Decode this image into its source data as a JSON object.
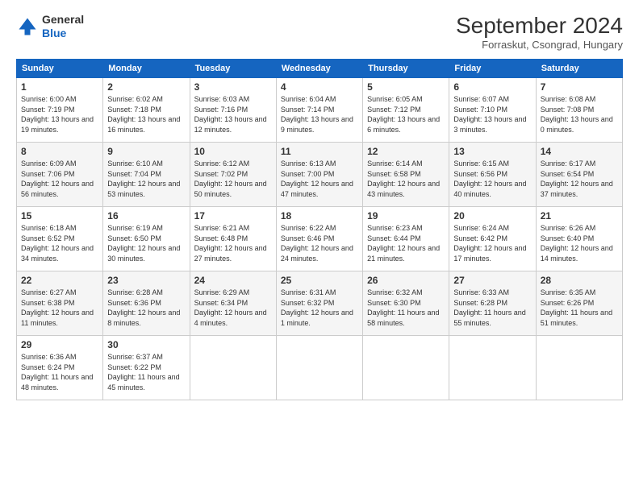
{
  "header": {
    "logo_line1": "General",
    "logo_line2": "Blue",
    "month_title": "September 2024",
    "location": "Forraskut, Csongrad, Hungary"
  },
  "weekdays": [
    "Sunday",
    "Monday",
    "Tuesday",
    "Wednesday",
    "Thursday",
    "Friday",
    "Saturday"
  ],
  "weeks": [
    [
      {
        "day": "1",
        "sunrise": "6:00 AM",
        "sunset": "7:19 PM",
        "daylight": "13 hours and 19 minutes."
      },
      {
        "day": "2",
        "sunrise": "6:02 AM",
        "sunset": "7:18 PM",
        "daylight": "13 hours and 16 minutes."
      },
      {
        "day": "3",
        "sunrise": "6:03 AM",
        "sunset": "7:16 PM",
        "daylight": "13 hours and 12 minutes."
      },
      {
        "day": "4",
        "sunrise": "6:04 AM",
        "sunset": "7:14 PM",
        "daylight": "13 hours and 9 minutes."
      },
      {
        "day": "5",
        "sunrise": "6:05 AM",
        "sunset": "7:12 PM",
        "daylight": "13 hours and 6 minutes."
      },
      {
        "day": "6",
        "sunrise": "6:07 AM",
        "sunset": "7:10 PM",
        "daylight": "13 hours and 3 minutes."
      },
      {
        "day": "7",
        "sunrise": "6:08 AM",
        "sunset": "7:08 PM",
        "daylight": "13 hours and 0 minutes."
      }
    ],
    [
      {
        "day": "8",
        "sunrise": "6:09 AM",
        "sunset": "7:06 PM",
        "daylight": "12 hours and 56 minutes."
      },
      {
        "day": "9",
        "sunrise": "6:10 AM",
        "sunset": "7:04 PM",
        "daylight": "12 hours and 53 minutes."
      },
      {
        "day": "10",
        "sunrise": "6:12 AM",
        "sunset": "7:02 PM",
        "daylight": "12 hours and 50 minutes."
      },
      {
        "day": "11",
        "sunrise": "6:13 AM",
        "sunset": "7:00 PM",
        "daylight": "12 hours and 47 minutes."
      },
      {
        "day": "12",
        "sunrise": "6:14 AM",
        "sunset": "6:58 PM",
        "daylight": "12 hours and 43 minutes."
      },
      {
        "day": "13",
        "sunrise": "6:15 AM",
        "sunset": "6:56 PM",
        "daylight": "12 hours and 40 minutes."
      },
      {
        "day": "14",
        "sunrise": "6:17 AM",
        "sunset": "6:54 PM",
        "daylight": "12 hours and 37 minutes."
      }
    ],
    [
      {
        "day": "15",
        "sunrise": "6:18 AM",
        "sunset": "6:52 PM",
        "daylight": "12 hours and 34 minutes."
      },
      {
        "day": "16",
        "sunrise": "6:19 AM",
        "sunset": "6:50 PM",
        "daylight": "12 hours and 30 minutes."
      },
      {
        "day": "17",
        "sunrise": "6:21 AM",
        "sunset": "6:48 PM",
        "daylight": "12 hours and 27 minutes."
      },
      {
        "day": "18",
        "sunrise": "6:22 AM",
        "sunset": "6:46 PM",
        "daylight": "12 hours and 24 minutes."
      },
      {
        "day": "19",
        "sunrise": "6:23 AM",
        "sunset": "6:44 PM",
        "daylight": "12 hours and 21 minutes."
      },
      {
        "day": "20",
        "sunrise": "6:24 AM",
        "sunset": "6:42 PM",
        "daylight": "12 hours and 17 minutes."
      },
      {
        "day": "21",
        "sunrise": "6:26 AM",
        "sunset": "6:40 PM",
        "daylight": "12 hours and 14 minutes."
      }
    ],
    [
      {
        "day": "22",
        "sunrise": "6:27 AM",
        "sunset": "6:38 PM",
        "daylight": "12 hours and 11 minutes."
      },
      {
        "day": "23",
        "sunrise": "6:28 AM",
        "sunset": "6:36 PM",
        "daylight": "12 hours and 8 minutes."
      },
      {
        "day": "24",
        "sunrise": "6:29 AM",
        "sunset": "6:34 PM",
        "daylight": "12 hours and 4 minutes."
      },
      {
        "day": "25",
        "sunrise": "6:31 AM",
        "sunset": "6:32 PM",
        "daylight": "12 hours and 1 minute."
      },
      {
        "day": "26",
        "sunrise": "6:32 AM",
        "sunset": "6:30 PM",
        "daylight": "11 hours and 58 minutes."
      },
      {
        "day": "27",
        "sunrise": "6:33 AM",
        "sunset": "6:28 PM",
        "daylight": "11 hours and 55 minutes."
      },
      {
        "day": "28",
        "sunrise": "6:35 AM",
        "sunset": "6:26 PM",
        "daylight": "11 hours and 51 minutes."
      }
    ],
    [
      {
        "day": "29",
        "sunrise": "6:36 AM",
        "sunset": "6:24 PM",
        "daylight": "11 hours and 48 minutes."
      },
      {
        "day": "30",
        "sunrise": "6:37 AM",
        "sunset": "6:22 PM",
        "daylight": "11 hours and 45 minutes."
      },
      null,
      null,
      null,
      null,
      null
    ]
  ]
}
